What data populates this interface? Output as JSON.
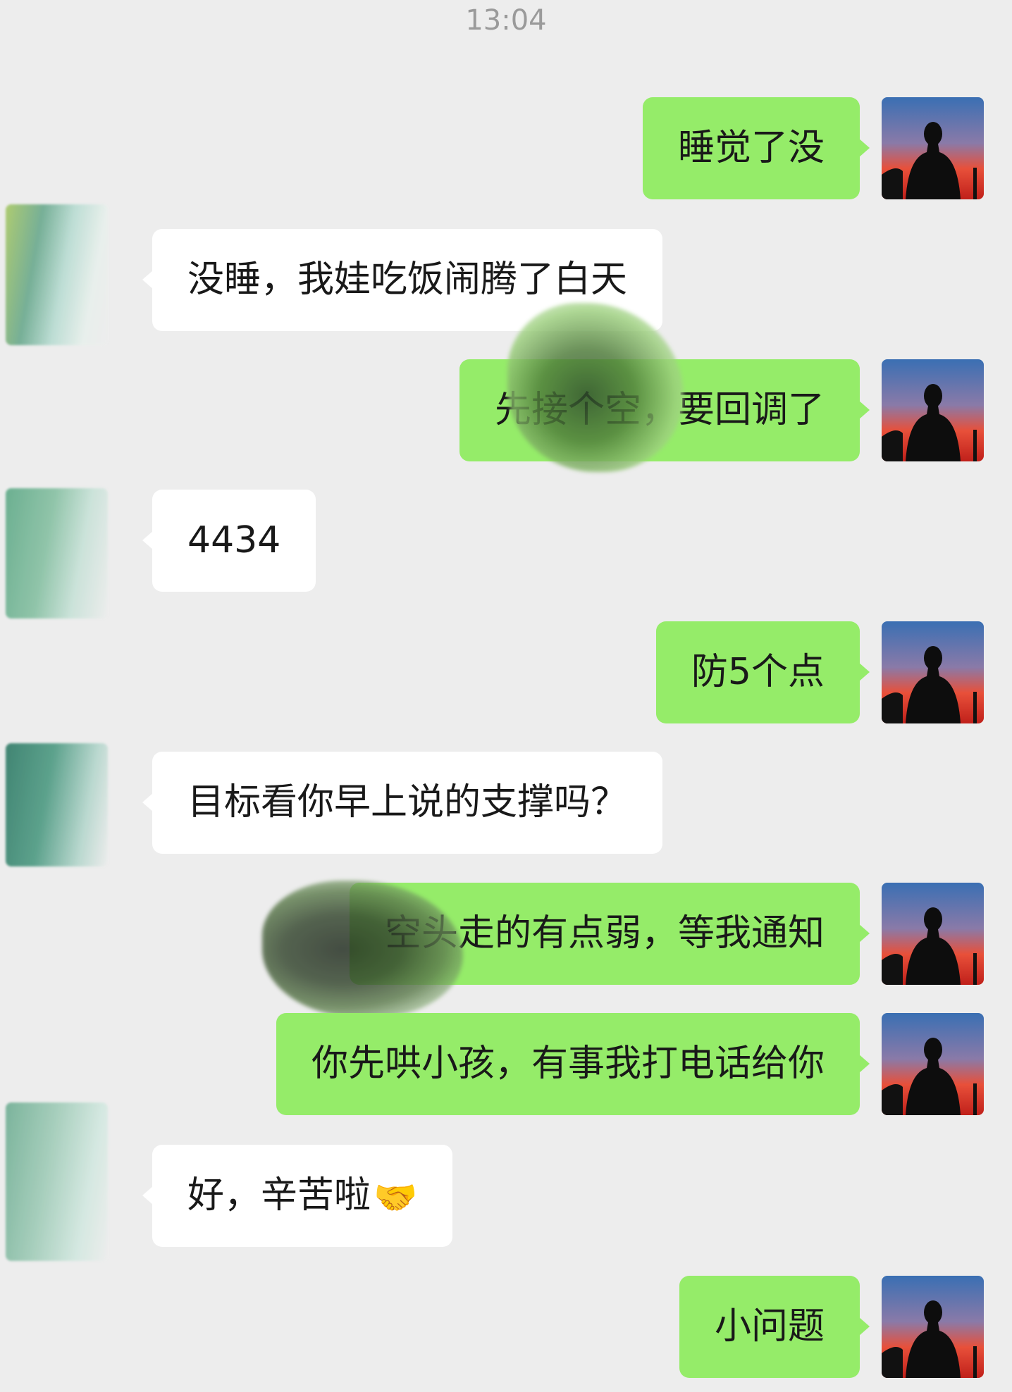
{
  "timestamp": "13:04",
  "colors": {
    "background": "#ededed",
    "outgoing_bubble": "#95ec69",
    "incoming_bubble": "#ffffff",
    "timestamp_text": "#9a9a9a"
  },
  "messages": [
    {
      "direction": "outgoing",
      "text": "睡觉了没"
    },
    {
      "direction": "incoming",
      "text": "没睡，我娃吃饭闹腾了白天"
    },
    {
      "direction": "outgoing",
      "text": "先接个空，要回调了"
    },
    {
      "direction": "incoming",
      "text": "4434"
    },
    {
      "direction": "outgoing",
      "text": "防5个点"
    },
    {
      "direction": "incoming",
      "text": "目标看你早上说的支撑吗？"
    },
    {
      "direction": "outgoing",
      "text": "空头走的有点弱，等我通知"
    },
    {
      "direction": "outgoing",
      "text": "你先哄小孩，有事我打电话给你"
    },
    {
      "direction": "incoming",
      "text": "好，辛苦啦",
      "emoji": "🤝",
      "emoji_icon": "handshake-icon"
    },
    {
      "direction": "outgoing",
      "text": "小问题"
    }
  ]
}
